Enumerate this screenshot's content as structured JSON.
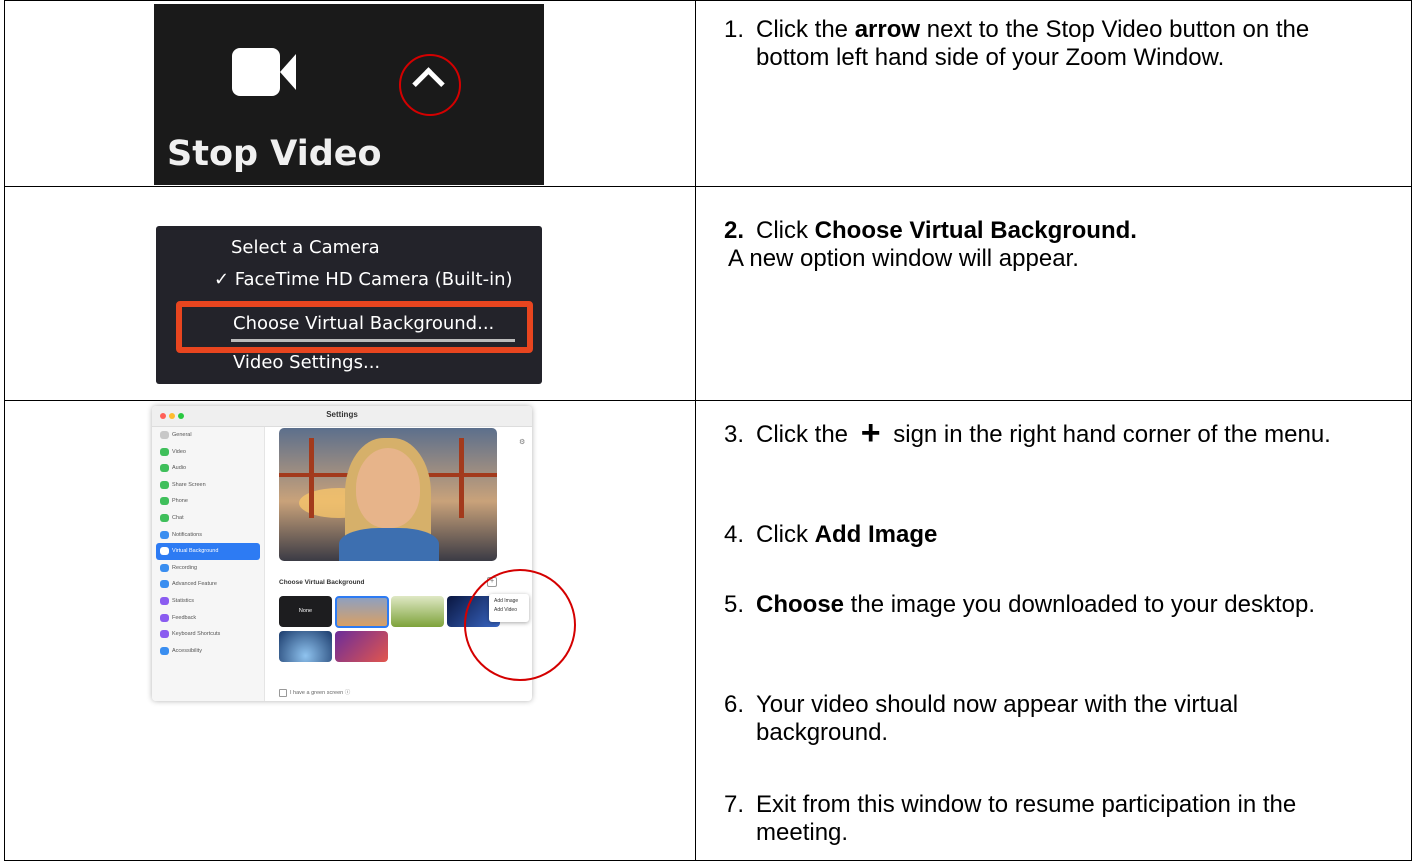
{
  "row1": {
    "zoom_button_label": "Stop Video",
    "step": {
      "num": "1.",
      "pre": "Click the ",
      "bold": "arrow",
      "post": " next to the Stop Video button on the bottom left hand side of your Zoom Window."
    }
  },
  "row2": {
    "menu": {
      "header": "Select a Camera",
      "camera_item": "✓ FaceTime HD Camera (Built-in)",
      "choose_item": "Choose Virtual Background...",
      "settings_item": "Video Settings..."
    },
    "step": {
      "num": "2.",
      "pre": "Click ",
      "bold": "Choose Virtual Background.",
      "line2": "A new option window will appear."
    }
  },
  "row3": {
    "settings": {
      "title": "Settings",
      "sidebar": [
        {
          "label": "General",
          "color": "#c8c8c8"
        },
        {
          "label": "Video",
          "color": "#3fbf5b"
        },
        {
          "label": "Audio",
          "color": "#3fbf5b"
        },
        {
          "label": "Share Screen",
          "color": "#3fbf5b"
        },
        {
          "label": "Phone",
          "color": "#3fbf5b"
        },
        {
          "label": "Chat",
          "color": "#3fbf5b"
        },
        {
          "label": "Notifications",
          "color": "#3a8ef0"
        },
        {
          "label": "Virtual Background",
          "color": "#ffffff",
          "active": true
        },
        {
          "label": "Recording",
          "color": "#3a8ef0"
        },
        {
          "label": "Advanced Feature",
          "color": "#3a8ef0"
        },
        {
          "label": "Statistics",
          "color": "#8a5cf0"
        },
        {
          "label": "Feedback",
          "color": "#8a5cf0"
        },
        {
          "label": "Keyboard Shortcuts",
          "color": "#8a5cf0"
        },
        {
          "label": "Accessibility",
          "color": "#3a8ef0"
        }
      ],
      "section_label": "Choose Virtual Background",
      "none_label": "None",
      "add_menu": [
        "Add Image",
        "Add Video"
      ],
      "green_screen": "I have a green screen"
    },
    "steps": [
      {
        "num": "3.",
        "pre": "Click the",
        "icon": "+",
        "post": "sign in the right hand corner of the menu."
      },
      {
        "num": "4.",
        "pre": "Click ",
        "bold": "Add Image"
      },
      {
        "num": "5.",
        "bold": "Choose",
        "post": " the image you downloaded to your desktop."
      },
      {
        "num": "6.",
        "post": "Your video should now appear with the virtual background."
      },
      {
        "num": "7.",
        "post": "Exit from this window to resume participation in the meeting."
      }
    ]
  }
}
